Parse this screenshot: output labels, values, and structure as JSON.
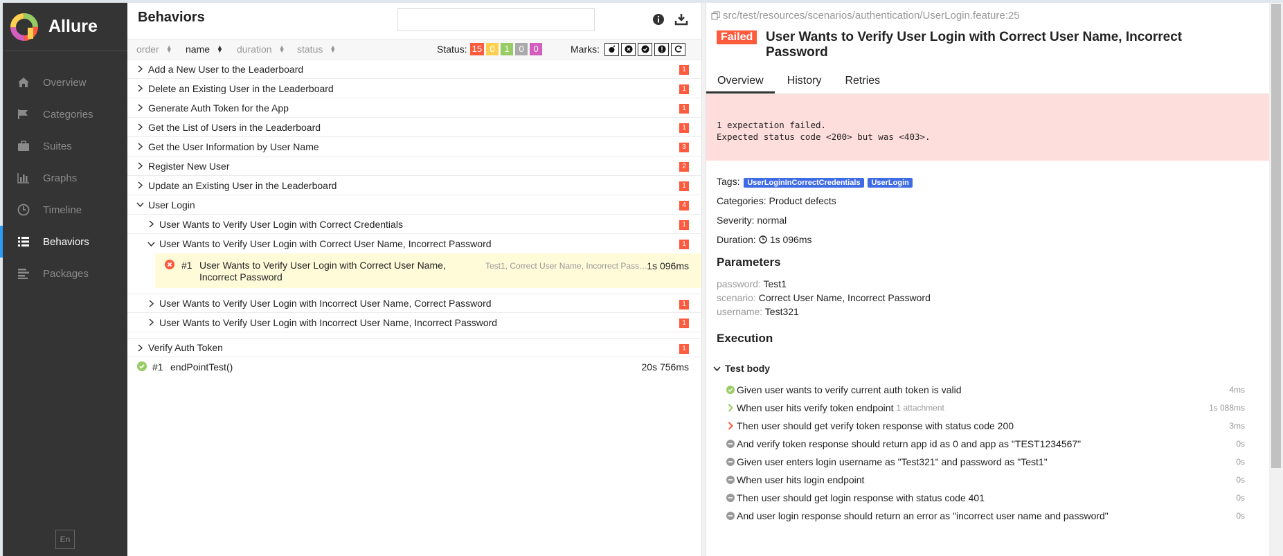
{
  "app": {
    "name": "Allure",
    "lang": "En"
  },
  "sidebar": {
    "items": [
      {
        "label": "Overview",
        "icon": "home-icon",
        "active": false
      },
      {
        "label": "Categories",
        "icon": "flag-icon",
        "active": false
      },
      {
        "label": "Suites",
        "icon": "briefcase-icon",
        "active": false
      },
      {
        "label": "Graphs",
        "icon": "bar-chart-icon",
        "active": false
      },
      {
        "label": "Timeline",
        "icon": "clock-icon",
        "active": false
      },
      {
        "label": "Behaviors",
        "icon": "list-icon",
        "active": true
      },
      {
        "label": "Packages",
        "icon": "align-left-icon",
        "active": false
      }
    ]
  },
  "behaviors": {
    "title": "Behaviors",
    "search_value": "",
    "sort": [
      {
        "label": "order",
        "active": false
      },
      {
        "label": "name",
        "active": true
      },
      {
        "label": "duration",
        "active": false
      },
      {
        "label": "status",
        "active": false
      }
    ],
    "status_label": "Status:",
    "status_counts": [
      {
        "value": "15",
        "color": "#fd5a3e"
      },
      {
        "value": "0",
        "color": "#ffd050"
      },
      {
        "value": "1",
        "color": "#97cc64"
      },
      {
        "value": "0",
        "color": "#aaaaaa"
      },
      {
        "value": "0",
        "color": "#d35ebe"
      }
    ],
    "marks_label": "Marks:",
    "marks": [
      "flaky-icon",
      "new-failed-icon",
      "new-passed-icon",
      "new-broken-icon",
      "retries-icon"
    ],
    "tree": [
      {
        "label": "Add a New User to the Leaderboard",
        "count": "1"
      },
      {
        "label": "Delete an Existing User in the Leaderboard",
        "count": "1"
      },
      {
        "label": "Generate Auth Token for the App",
        "count": "1"
      },
      {
        "label": "Get the List of Users in the Leaderboard",
        "count": "1"
      },
      {
        "label": "Get the User Information by User Name",
        "count": "3"
      },
      {
        "label": "Register New User",
        "count": "2"
      },
      {
        "label": "Update an Existing User in the Leaderboard",
        "count": "1"
      },
      {
        "label": "User Login",
        "count": "4"
      },
      {
        "label": "User Wants to Verify User Login with Correct Credentials",
        "count": "1"
      },
      {
        "label": "User Wants to Verify User Login with Correct User Name, Incorrect Password",
        "count": "1"
      },
      {
        "label": "User Wants to Verify User Login with Incorrect User Name, Correct Password",
        "count": "1"
      },
      {
        "label": "User Wants to Verify User Login with Incorrect User Name, Incorrect Password",
        "count": "1"
      },
      {
        "label": "Verify Auth Token",
        "count": "1"
      }
    ],
    "selected_leaf": {
      "num": "#1",
      "title": "User Wants to Verify User Login with Correct User Name, Incorrect Password",
      "params": "Test1, Correct User Name, Incorrect Passw...",
      "duration": "1s 096ms"
    },
    "end_leaf": {
      "num": "#1",
      "title": "endPointTest()",
      "duration": "20s 756ms"
    }
  },
  "detail": {
    "path": "src/test/resources/scenarios/authentication/UserLogin.feature:25",
    "status": "Failed",
    "title": "User Wants to Verify User Login with Correct User Name, Incorrect Password",
    "tabs": [
      "Overview",
      "History",
      "Retries"
    ],
    "error": "1 expectation failed.\nExpected status code <200> but was <403>.",
    "tags_label": "Tags:",
    "tags": [
      "UserLoginInCorrectCredentials",
      "UserLogin"
    ],
    "categories": "Categories: Product defects",
    "severity": "Severity: normal",
    "duration_label": "Duration:",
    "duration": "1s 096ms",
    "parameters_heading": "Parameters",
    "parameters": [
      {
        "name": "password:",
        "value": "Test1"
      },
      {
        "name": "scenario:",
        "value": "Correct User Name, Incorrect Password"
      },
      {
        "name": "username:",
        "value": "Test321"
      }
    ],
    "execution_heading": "Execution",
    "test_body": "Test body",
    "steps": [
      {
        "text": "Given user wants to verify current auth token is valid",
        "status": "passed",
        "attachment": "",
        "duration": "4ms"
      },
      {
        "text": "When user hits verify token endpoint",
        "status": "passed-expand",
        "attachment": "1 attachment",
        "duration": "1s 088ms"
      },
      {
        "text": "Then user should get verify token response with status code 200",
        "status": "failed-expand",
        "attachment": "",
        "duration": "3ms"
      },
      {
        "text": "And verify token response should return app id as 0 and app as \"TEST1234567\"",
        "status": "skipped",
        "attachment": "",
        "duration": "0s"
      },
      {
        "text": "Given user enters login username as \"Test321\" and password as \"Test1\"",
        "status": "skipped",
        "attachment": "",
        "duration": "0s"
      },
      {
        "text": "When user hits login endpoint",
        "status": "skipped",
        "attachment": "",
        "duration": "0s"
      },
      {
        "text": "Then user should get login response with status code 401",
        "status": "skipped",
        "attachment": "",
        "duration": "0s"
      },
      {
        "text": "And user login response should return an error as \"incorrect user name and password\"",
        "status": "skipped",
        "attachment": "",
        "duration": "0s"
      }
    ]
  }
}
